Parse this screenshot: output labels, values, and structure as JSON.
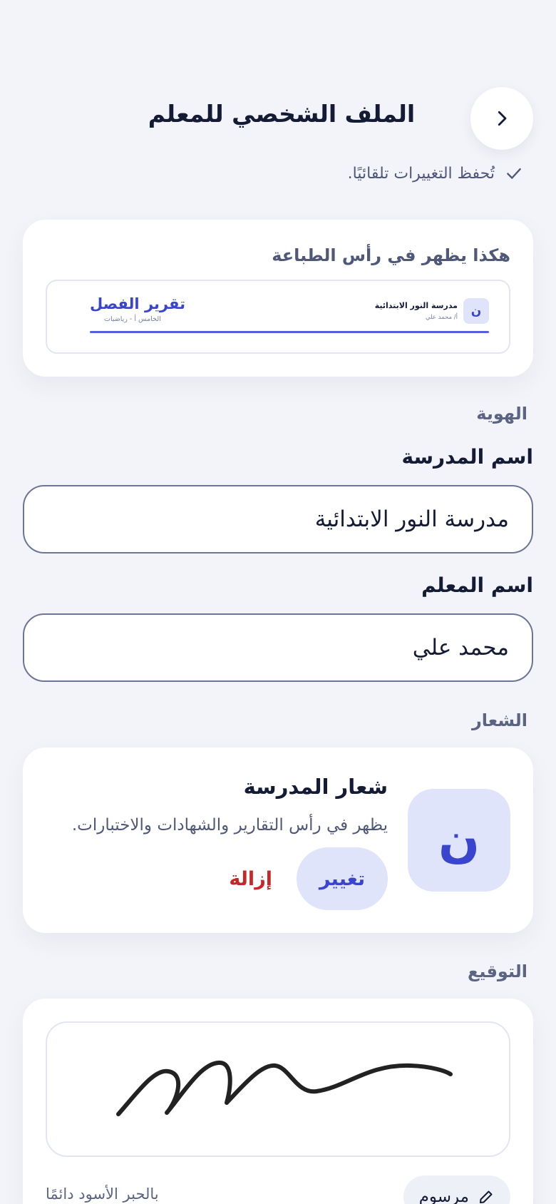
{
  "header": {
    "title": "الملف الشخصي للمعلم",
    "autosave_text": "تُحفظ التغييرات تلقائيًا."
  },
  "print_preview": {
    "heading": "هكذا يظهر في رأس الطباعة",
    "logo_letter": "ن",
    "school_name": "مدرسة النور الابتدائية",
    "teacher_line": "أ/ محمد علي",
    "report_title": "تقرير الفصل",
    "class_line": "الخامس أ - رياضيات",
    "accent_color": "#5360d8"
  },
  "identity": {
    "section_label": "الهوية",
    "school_field": {
      "label": "اسم المدرسة",
      "value": "مدرسة النور الابتدائية"
    },
    "teacher_field": {
      "label": "اسم المعلم",
      "value": "محمد علي"
    }
  },
  "logo_section": {
    "section_label": "الشعار",
    "logo_letter": "ن",
    "title": "شعار المدرسة",
    "description": "يظهر في رأس التقارير والشهادات والاختبارات.",
    "change_label": "تغيير",
    "remove_label": "إزالة"
  },
  "signature_section": {
    "section_label": "التوقيع",
    "mode_label": "مرسوم",
    "ink_note": "بالحبر الأسود دائمًا"
  },
  "colors": {
    "accent": "#3a45cf",
    "accent_soft": "#e0e4fb",
    "danger": "#c62828",
    "background": "#f3f4f9"
  }
}
